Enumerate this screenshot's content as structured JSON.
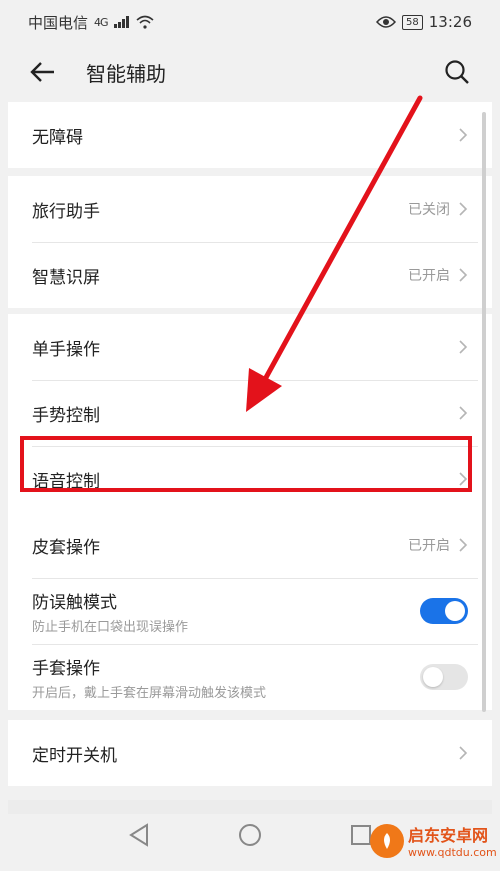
{
  "status": {
    "carrier": "中国电信",
    "network": "4G",
    "battery": "58",
    "time": "13:26"
  },
  "header": {
    "title": "智能辅助"
  },
  "sections": {
    "a": {
      "items": [
        {
          "label": "无障碍",
          "value": ""
        }
      ]
    },
    "b": {
      "items": [
        {
          "label": "旅行助手",
          "value": "已关闭"
        },
        {
          "label": "智慧识屏",
          "value": "已开启"
        }
      ]
    },
    "c": {
      "items": [
        {
          "label": "单手操作",
          "value": ""
        },
        {
          "label": "手势控制",
          "value": ""
        },
        {
          "label": "语音控制",
          "value": ""
        }
      ]
    },
    "d": {
      "items": [
        {
          "label": "皮套操作",
          "value": "已开启"
        },
        {
          "label": "防误触模式",
          "sub": "防止手机在口袋出现误操作",
          "toggle": 1
        },
        {
          "label": "手套操作",
          "sub": "开启后，戴上手套在屏幕滑动触发该模式",
          "toggle": 0
        }
      ]
    },
    "e": {
      "items": [
        {
          "label": "定时开关机",
          "value": ""
        }
      ]
    }
  },
  "colors": {
    "accent": "#1a73e8",
    "annotation": "#e3121b"
  },
  "watermark": {
    "title": "启东安卓网",
    "url": "www.qdtdu.com"
  }
}
